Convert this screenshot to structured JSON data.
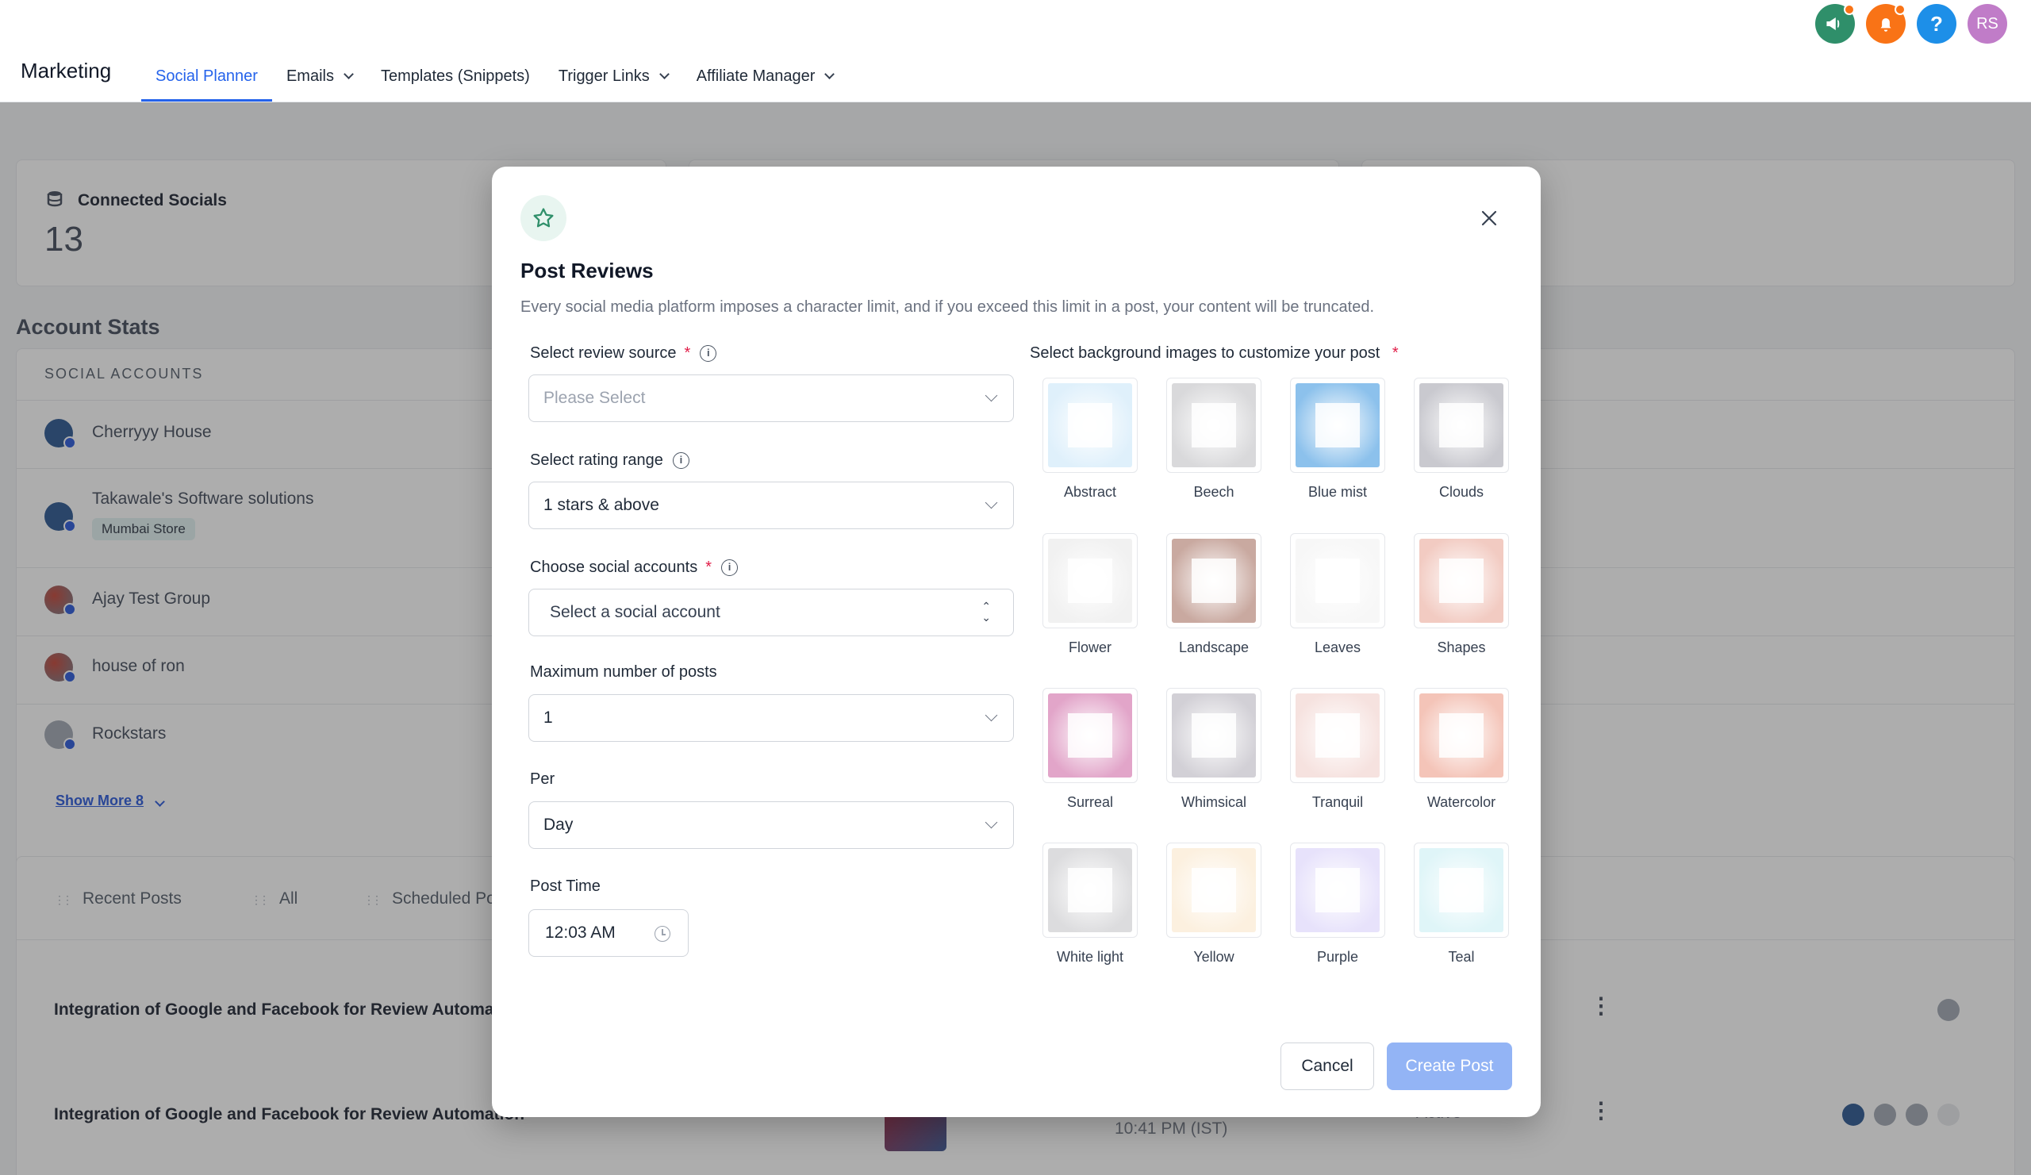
{
  "header": {
    "brand": "Marketing",
    "tabs": [
      {
        "label": "Social Planner",
        "active": true
      },
      {
        "label": "Emails",
        "dropdown": true
      },
      {
        "label": "Templates (Snippets)"
      },
      {
        "label": "Trigger Links",
        "dropdown": true
      },
      {
        "label": "Affiliate Manager",
        "dropdown": true
      }
    ],
    "icons": [
      "megaphone-icon",
      "bell-icon",
      "help-icon"
    ],
    "avatar_initials": "RS"
  },
  "background": {
    "connected_socials_label": "Connected Socials",
    "connected_socials_count": "13",
    "account_stats_title": "Account Stats",
    "social_accounts_header": "SOCIAL ACCOUNTS",
    "accounts": [
      {
        "name": "Cherryyy House"
      },
      {
        "name": "Takawale's Software solutions",
        "badge": "Mumbai Store"
      },
      {
        "name": "Ajay Test Group"
      },
      {
        "name": "house of ron"
      },
      {
        "name": "Rockstars"
      }
    ],
    "show_more": "Show More 8",
    "post_tabs": [
      "Recent Posts",
      "All",
      "Scheduled Po"
    ],
    "posts": [
      {
        "title": "Integration of Google and Facebook for Review Automat"
      },
      {
        "title": "Integration of Google and Facebook for Review Automation",
        "time": "10:41 PM (IST)",
        "status": "Active"
      }
    ]
  },
  "modal": {
    "title": "Post Reviews",
    "description": "Every social media platform imposes a character limit, and if you exceed this limit in a post, your content will be truncated.",
    "fields": {
      "review_source": {
        "label": "Select review source",
        "required": "*",
        "placeholder": "Please Select"
      },
      "rating_range": {
        "label": "Select rating range",
        "value": "1 stars & above"
      },
      "social_accounts": {
        "label": "Choose social accounts",
        "required": "*",
        "placeholder": "Select a social account"
      },
      "max_posts": {
        "label": "Maximum number of posts",
        "value": "1"
      },
      "per": {
        "label": "Per",
        "value": "Day"
      },
      "post_time": {
        "label": "Post Time",
        "value": "12:03 AM"
      }
    },
    "backgrounds_label": "Select background images to customize your post",
    "backgrounds_required": "*",
    "backgrounds": [
      {
        "name": "Abstract",
        "color": "#dff0fb"
      },
      {
        "name": "Beech",
        "color": "#d9d9db"
      },
      {
        "name": "Blue mist",
        "color": "#8cc1ec"
      },
      {
        "name": "Clouds",
        "color": "#c9c9cf"
      },
      {
        "name": "Flower",
        "color": "#f1f1f1"
      },
      {
        "name": "Landscape",
        "color": "#c9a9a0"
      },
      {
        "name": "Leaves",
        "color": "#f7f7f7"
      },
      {
        "name": "Shapes",
        "color": "#f2cbc2"
      },
      {
        "name": "Surreal",
        "color": "#e2a5c9"
      },
      {
        "name": "Whimsical",
        "color": "#d2d0d6"
      },
      {
        "name": "Tranquil",
        "color": "#f6e2df"
      },
      {
        "name": "Watercolor",
        "color": "#f4c4b8"
      },
      {
        "name": "White light",
        "color": "#dcdcde"
      },
      {
        "name": "Yellow",
        "color": "#fcf0df"
      },
      {
        "name": "Purple",
        "color": "#e7e2fb"
      },
      {
        "name": "Teal",
        "color": "#dff5f8"
      }
    ],
    "cancel_label": "Cancel",
    "create_label": "Create Post"
  }
}
